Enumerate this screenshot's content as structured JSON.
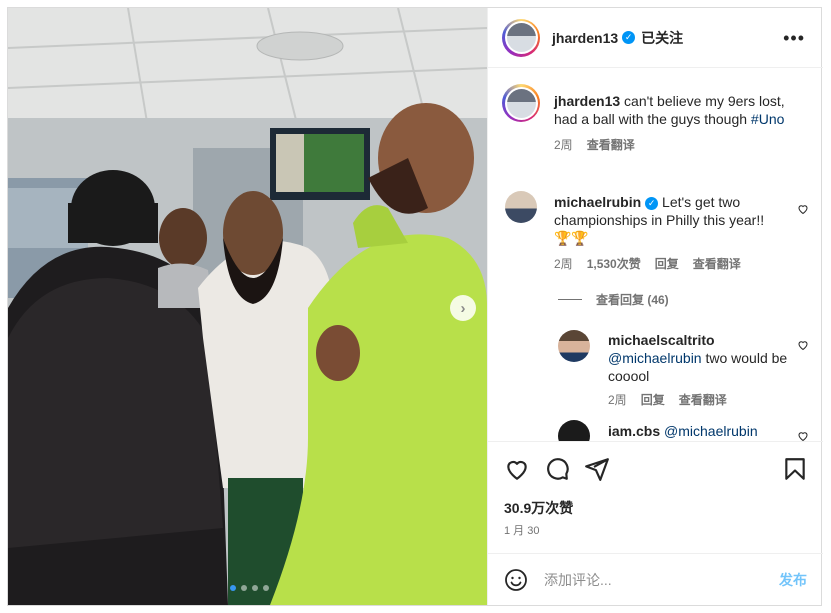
{
  "post": {
    "username": "jharden13",
    "follow_label": "已关注",
    "more_label": "•••",
    "caption": {
      "username": "jharden13",
      "text": "can't believe my 9ers lost, had a ball with the guys though",
      "hashtag": "#Uno",
      "time": "2周",
      "translate": "查看翻译"
    },
    "likes": "30.9万次赞",
    "date": "1 月 30",
    "add_comment_placeholder": "添加评论...",
    "post_label": "发布",
    "carousel_count": 4
  },
  "comments": [
    {
      "username": "michaelrubin",
      "verified": true,
      "text": "Let's get two championships in Philly this year!!",
      "emoji": "🏆🏆",
      "time": "2周",
      "likes": "1,530次赞",
      "reply": "回复",
      "translate": "查看翻译",
      "view_replies": "查看回复 (46)"
    },
    {
      "username": "michaelscaltrito",
      "mention": "@michaelrubin",
      "text": "two would be cooool",
      "time": "2周",
      "reply": "回复",
      "translate": "查看翻译"
    },
    {
      "username": "iam.cbs",
      "mention": "@michaelrubin",
      "text": ""
    }
  ],
  "colors": {
    "accent": "#0095f6",
    "jacket": "#b8e04a",
    "hoodie": "#ece9e4"
  },
  "icons": [
    "heart-icon",
    "comment-icon",
    "share-icon",
    "bookmark-icon",
    "emoji-icon",
    "more-icon",
    "verified-icon",
    "chevron-right-icon"
  ]
}
